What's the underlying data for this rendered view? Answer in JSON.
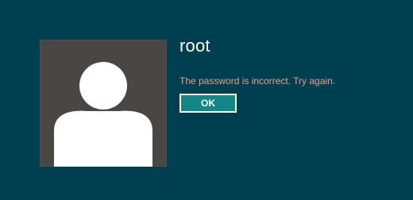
{
  "login": {
    "username": "root",
    "error_message": "The password is incorrect. Try again.",
    "ok_label": "OK"
  },
  "avatar": {
    "icon": "user-silhouette-icon"
  },
  "colors": {
    "background": "#003f4f",
    "avatar_background": "#494643",
    "error_text": "#e8a08a",
    "button_background": "#138785",
    "button_border": "#ffffff",
    "text_primary": "#ffffff"
  }
}
